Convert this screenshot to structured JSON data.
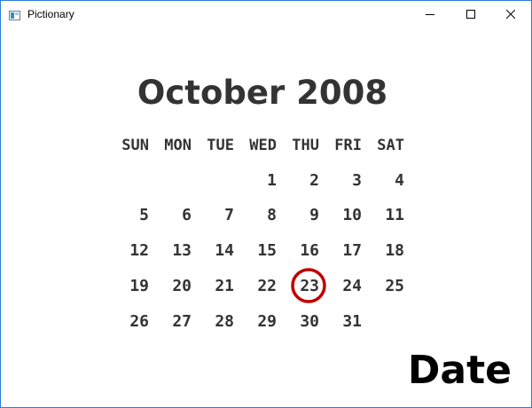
{
  "window": {
    "title": "Pictionary"
  },
  "calendar": {
    "title": "October 2008",
    "weekdays": [
      "SUN",
      "MON",
      "TUE",
      "WED",
      "THU",
      "FRI",
      "SAT"
    ],
    "first_weekday_index": 3,
    "days_in_month": 31,
    "circled_day": "23",
    "circle_color": "#c00000"
  },
  "answer": {
    "word": "Date"
  }
}
